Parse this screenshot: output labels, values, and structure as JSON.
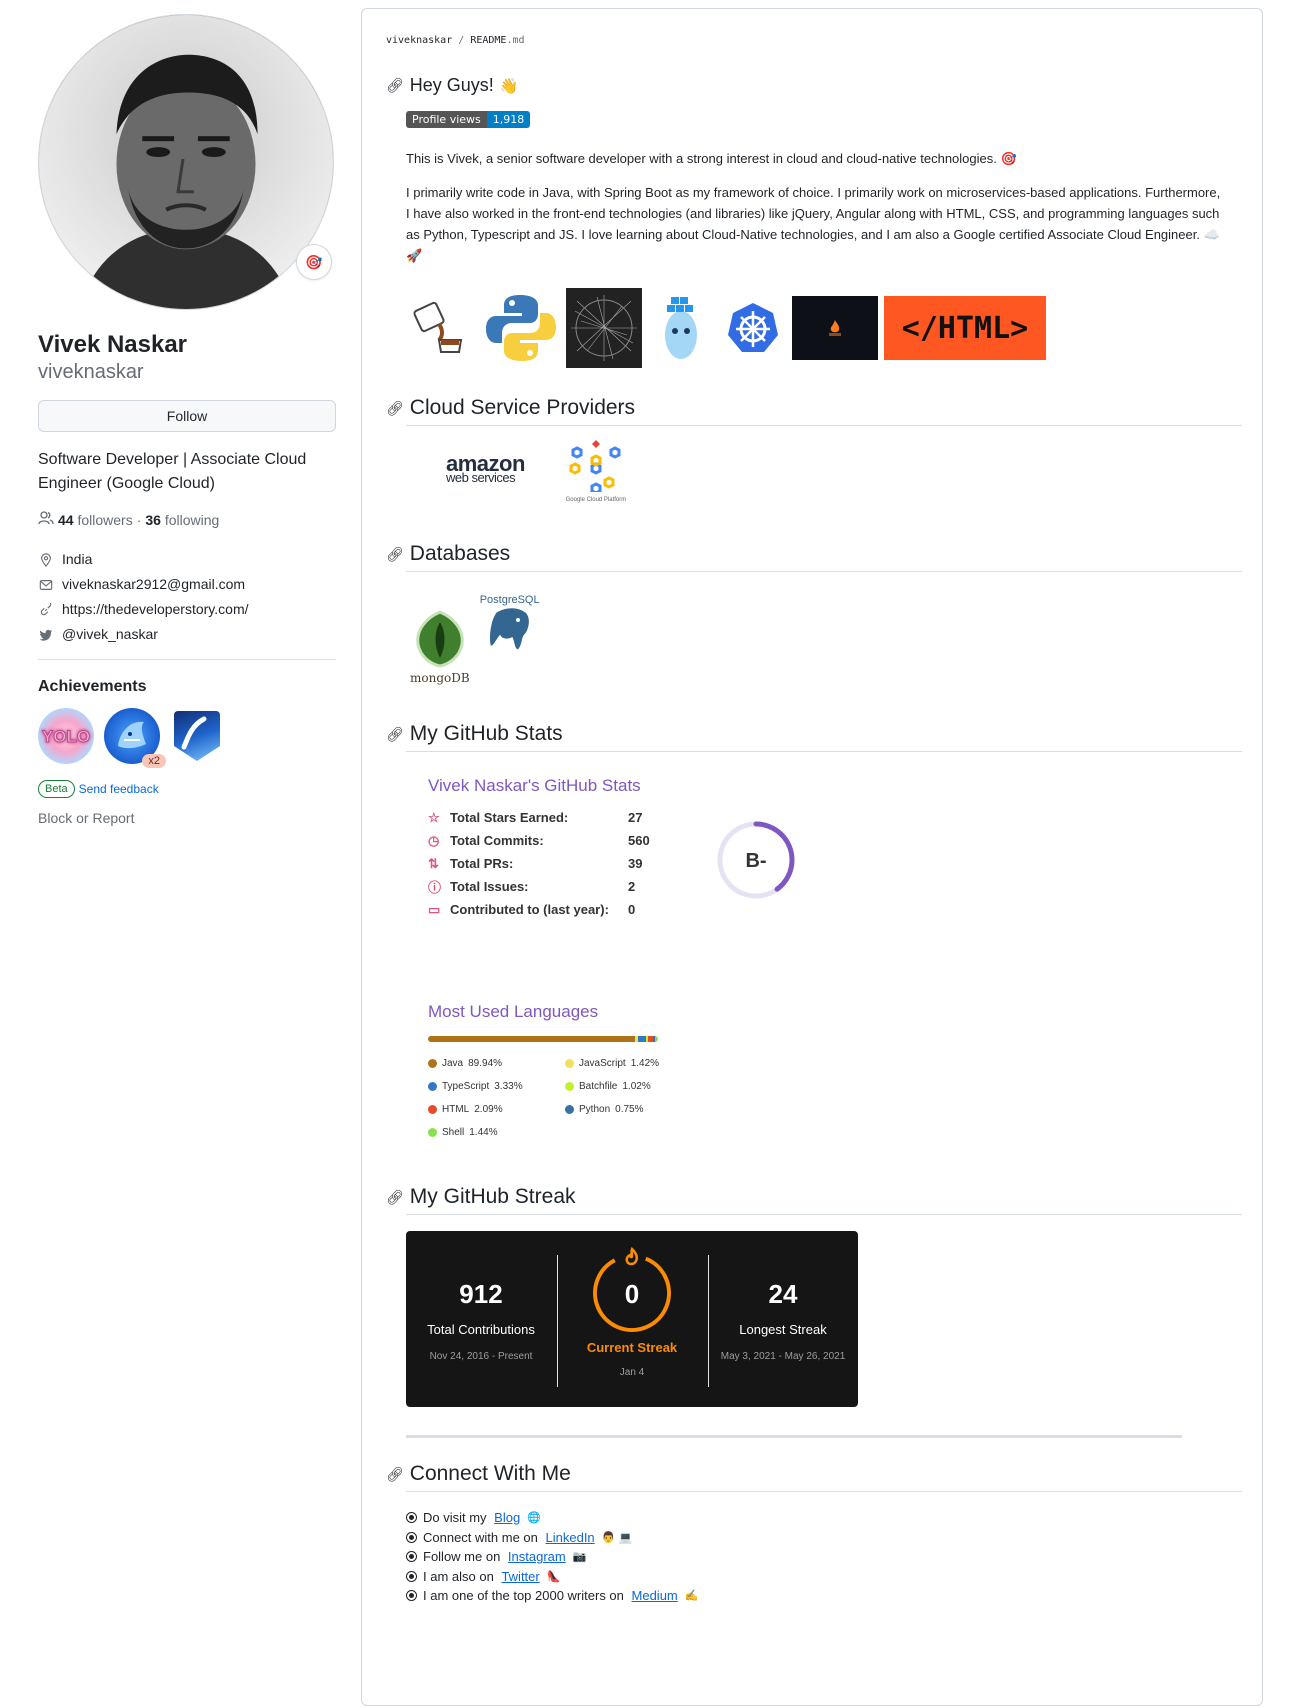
{
  "profile": {
    "name": "Vivek Naskar",
    "login": "viveknaskar",
    "status_emoji": "🎯",
    "follow_label": "Follow",
    "bio": "Software Developer | Associate Cloud Engineer (Google Cloud)",
    "followers_count": "44",
    "followers_label": "followers",
    "separator": "·",
    "following_count": "36",
    "following_label": "following",
    "location": "India",
    "email": "viveknaskar2912@gmail.com",
    "website": "https://thedeveloperstory.com/",
    "twitter": "@vivek_naskar",
    "achievements_title": "Achievements",
    "achievements": [
      {
        "name": "YOLO",
        "icon": "yolo-badge-icon"
      },
      {
        "name": "Pull Shark",
        "icon": "pull-shark-badge-icon",
        "multiplier": "x2"
      },
      {
        "name": "Quickdraw",
        "icon": "quickdraw-badge-icon"
      }
    ],
    "beta_label": "Beta",
    "feedback_label": "Send feedback",
    "block_label": "Block or Report"
  },
  "readme": {
    "crumb_user": "viveknaskar",
    "crumb_sep": "/",
    "crumb_file": "README",
    "crumb_ext": ".md",
    "greeting": "Hey Guys!",
    "greeting_emoji": "👋",
    "views_label": "Profile views",
    "views_count": "1,918",
    "intro": "This is Vivek, a senior software developer with a strong interest in cloud and cloud-native technologies. 🎯",
    "about": "I primarily write code in Java, with Spring Boot as my framework of choice. I primarily work on microservices-based applications. Furthermore, I have also worked in the front-end technologies (and libraries) like jQuery, Angular along with HTML, CSS, and programming languages such as Python, Typescript and JS. I love learning about Cloud-Native technologies, and I am also a Google certified Associate Cloud Engineer. ☁️ 🚀",
    "html_logo_text": "</HTML>",
    "section_cloud": "Cloud Service Providers",
    "aws_line1": "amazon",
    "aws_line2": "web services",
    "gcp_caption": "Google Cloud Platform",
    "section_db": "Databases",
    "mongo_label": "mongoDB",
    "postgres_label": "PostgreSQL",
    "section_stats": "My GitHub Stats",
    "stats_title": "Vivek Naskar's GitHub Stats",
    "stats": [
      {
        "label": "Total Stars Earned:",
        "value": "27",
        "icon": "star-icon"
      },
      {
        "label": "Total Commits:",
        "value": "560",
        "icon": "history-icon"
      },
      {
        "label": "Total PRs:",
        "value": "39",
        "icon": "pull-request-icon"
      },
      {
        "label": "Total Issues:",
        "value": "2",
        "icon": "issue-icon"
      },
      {
        "label": "Contributed to (last year):",
        "value": "0",
        "icon": "repo-icon"
      }
    ],
    "grade": "B-",
    "grade_progress": 0.4,
    "langs_title": "Most Used Languages",
    "languages": [
      {
        "name": "Java",
        "pct": "89.94%",
        "value": 89.94,
        "color": "#b07219"
      },
      {
        "name": "JavaScript",
        "pct": "1.42%",
        "value": 1.42,
        "color": "#f1e05a"
      },
      {
        "name": "TypeScript",
        "pct": "3.33%",
        "value": 3.33,
        "color": "#3178c6"
      },
      {
        "name": "Batchfile",
        "pct": "1.02%",
        "value": 1.02,
        "color": "#C1F12E"
      },
      {
        "name": "HTML",
        "pct": "2.09%",
        "value": 2.09,
        "color": "#e34c26"
      },
      {
        "name": "Python",
        "pct": "0.75%",
        "value": 0.75,
        "color": "#3572A5"
      },
      {
        "name": "Shell",
        "pct": "1.44%",
        "value": 1.44,
        "color": "#89e051"
      }
    ],
    "section_streak": "My GitHub Streak",
    "streak": {
      "total": "912",
      "total_label": "Total Contributions",
      "total_range": "Nov 24, 2016 - Present",
      "current": "0",
      "current_label": "Current Streak",
      "current_range": "Jan 4",
      "longest": "24",
      "longest_label": "Longest Streak",
      "longest_range": "May 3, 2021 - May 26, 2021"
    },
    "section_connect": "Connect With Me",
    "connect": [
      {
        "pre": "Do visit my ",
        "link": "Blog",
        "post": " 🌐"
      },
      {
        "pre": "Connect with me on ",
        "link": "LinkedIn",
        "post": " 👨 💻"
      },
      {
        "pre": "Follow me on ",
        "link": "Instagram",
        "post": " 📷"
      },
      {
        "pre": "I am also on ",
        "link": "Twitter",
        "post": " 👠"
      },
      {
        "pre": "I am one of the top 2000 writers on ",
        "link": "Medium",
        "post": " ✍️"
      }
    ]
  },
  "colors": {
    "link": "#0969da",
    "stats_title": "#7e57c2",
    "stats_icon": "#e0557a",
    "streak_bg": "#151515",
    "streak_accent": "#fb8c00"
  }
}
